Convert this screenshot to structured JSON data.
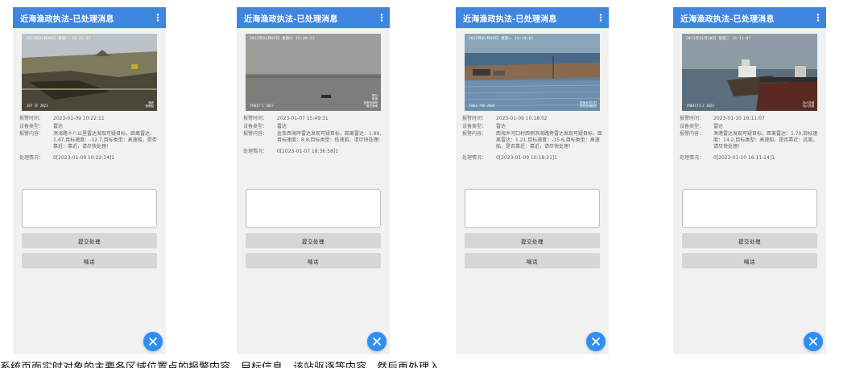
{
  "screens": [
    {
      "title": "近海渔政执法-已处理消息",
      "photo": {
        "stamp": "2023年01月09日 星期一 10:22:11",
        "code": "JSY 1F  2023",
        "corner": "渔政\n渔政船"
      },
      "alarm_time": "2023-01-09 10:22:11",
      "device_type": "雷达",
      "content": "滨海路十八公里雷达发现可疑目标，距离雷达：1.47,目标速度：-12.7,目标类型：高速船，是否靠近：靠近，请尽快处理!",
      "status": "0[2023-01-09 10:22:34]1"
    },
    {
      "title": "近海渔政执法-已处理消息",
      "photo": {
        "stamp": "2023年01月07日 星期六 15:49:31",
        "code": "FN617-1  2017",
        "corner": "雪口\n航道\n金条西海岸\n雪达渔港"
      },
      "alarm_time": "2023-01-07 15:49:31",
      "device_type": "雷达",
      "content": "金条西海岸雷达发现可疑目标，距离雷达：1.99,目标速度：8.8,目标类型：低速船，请尽快处理!",
      "status": "0[2023-01-07 18:36:58]1"
    },
    {
      "title": "近海渔政执法-已处理消息",
      "photo": {
        "stamp": "2023年01月09日 星期一 10:18:02",
        "code": "FN63-796  2020",
        "corner": "西海乡河口村\n西侧滨海路旁"
      },
      "alarm_time": "2023-01-09 10:18:02",
      "device_type": "雷达",
      "content": "西海乡河口村西侧滨海路旁雷达发现可疑目标，距离雷达：1.21,目标速度：-15.6,目标类型：高速船，是否靠近：靠近，请尽快处理!",
      "status": "0[2023-01-09 10:18:21]1"
    },
    {
      "title": "近海渔政执法-已处理消息",
      "photo": {
        "stamp": "2023年01月10日 星期二 16:11:07",
        "code": "FN64173-3  2023",
        "corner": "仙人岛港\n仙人岛港"
      },
      "alarm_time": "2023-01-10 16:11:07",
      "device_type": "雷达",
      "content": "渔港雷达发现可疑目标，距离雷达：1.70,目标速度：14.2,目标类型：高速船，是否靠近：远离，请尽快处理!",
      "status": "0[2023-01-10 16:11:24]1"
    }
  ],
  "labels": {
    "alarm_time": "报警时间：",
    "device_type": "设备类型：",
    "content": "报警内容：",
    "status": "处理情况："
  },
  "buttons": {
    "submit": "提交处理",
    "shout": "喊话"
  },
  "icons": {
    "menu": "more-vertical-icon",
    "fab": "close-icon"
  },
  "colors": {
    "appbar": "#3f86e0",
    "fab": "#2f8ef4"
  },
  "caption": "系统页面实时对象的主要各区域位置点的报警内容，目标信息，该站驱逐等内容，然后再处理入"
}
